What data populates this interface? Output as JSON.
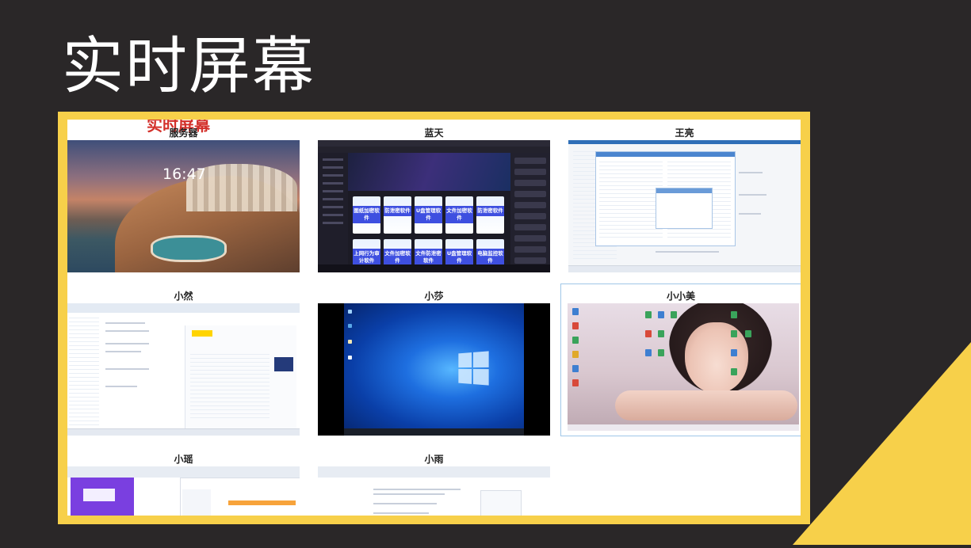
{
  "page": {
    "title": "实时屏幕"
  },
  "board_header_fragment": "实时屏幕",
  "tiles": [
    {
      "name": "服务器",
      "clock": "16:47"
    },
    {
      "name": "蓝天",
      "cards": [
        "图纸加密软件",
        "防泄密软件",
        "U盘管理软件",
        "文件加密软件",
        "防泄密软件",
        "上网行为审计软件",
        "文件加密软件",
        "文件防泄密软件",
        "U盘管理软件",
        "电脑监控软件",
        "文件防泄密软件"
      ]
    },
    {
      "name": "王亮"
    },
    {
      "name": "小然"
    },
    {
      "name": "小莎"
    },
    {
      "name": "小小美"
    },
    {
      "name": "小瑶"
    },
    {
      "name": "小雨"
    }
  ],
  "colors": {
    "frame": "#f7d04a",
    "background": "#2a2728",
    "title": "#ffffff",
    "accent": "#d3312b"
  }
}
